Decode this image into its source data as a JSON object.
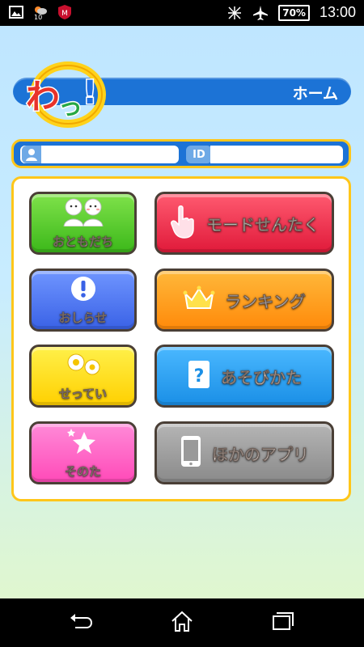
{
  "status_bar": {
    "notification_badge": "10",
    "battery": "70%",
    "time": "13:00"
  },
  "header": {
    "logo_text": "わっ!",
    "title": "ホーム"
  },
  "id_bar": {
    "id_label": "ID",
    "name_value": "",
    "id_value": ""
  },
  "menu": {
    "friends": "おともだち",
    "mode_select": "モードせんたく",
    "notice": "おしらせ",
    "ranking": "ランキング",
    "settings": "せってい",
    "how_to_play": "あそびかた",
    "others": "そのた",
    "other_apps": "ほかのアプリ"
  },
  "colors": {
    "header_blue": "#1c73d6",
    "frame_yellow": "#ffc61a",
    "green": "#5bd02a",
    "red": "#f0304e",
    "blue": "#4a7bf0",
    "orange": "#ff9a1a",
    "yellow": "#ffe01a",
    "sky": "#25a2f0",
    "pink": "#ff5fc8",
    "gray": "#9a9a9a"
  },
  "icons": [
    "two-people-icon",
    "pointing-hand-icon",
    "exclamation-icon",
    "crown-icon",
    "gears-icon",
    "question-icon",
    "star-icon",
    "phone-icon"
  ]
}
